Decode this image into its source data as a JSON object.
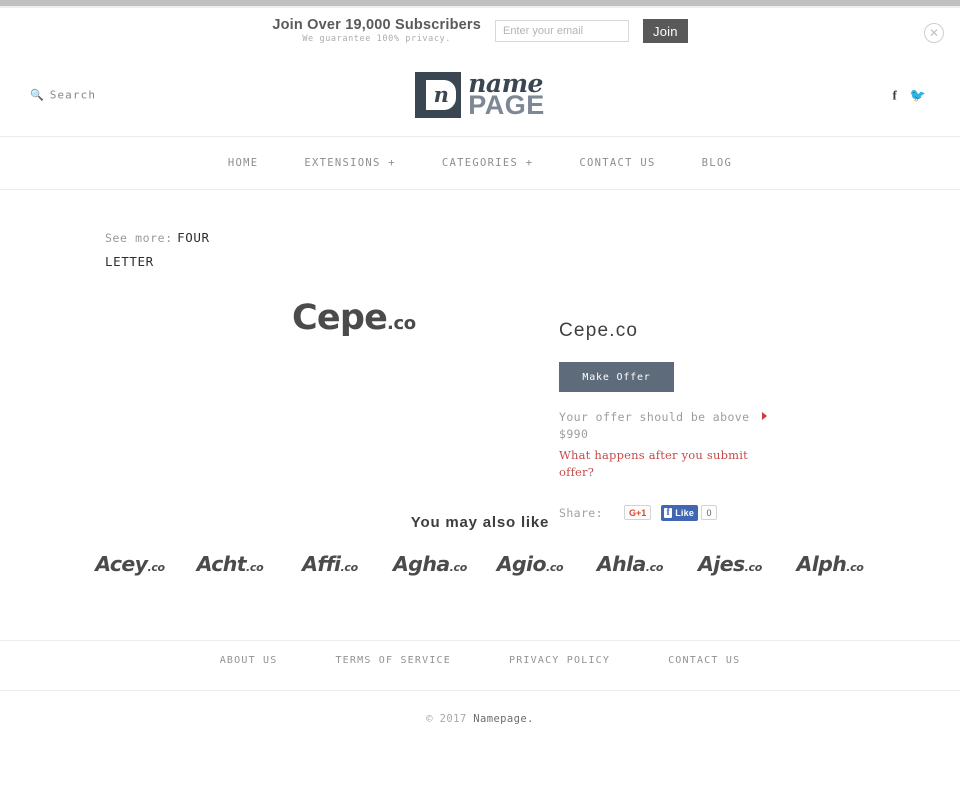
{
  "newsletter": {
    "title": "Join Over 19,000 Subscribers",
    "subtitle": "We guarantee 100% privacy.",
    "email_placeholder": "Enter your email",
    "email_value": "",
    "join_label": "Join",
    "close_icon": "close-circle-icon"
  },
  "header": {
    "search_label": "Search",
    "search_icon": "search-icon",
    "logo": {
      "mark_letter": "n",
      "word_top": "name",
      "word_bottom": "PAGE"
    },
    "social": [
      {
        "name": "facebook-icon",
        "glyph": "f"
      },
      {
        "name": "twitter-icon",
        "glyph": "🐦"
      }
    ]
  },
  "nav": {
    "items": [
      {
        "label": "HOME"
      },
      {
        "label": "EXTENSIONS +"
      },
      {
        "label": "CATEGORIES +"
      },
      {
        "label": "CONTACT US"
      },
      {
        "label": "BLOG"
      }
    ]
  },
  "breadcrumb": {
    "prefix": "See more:",
    "link": "FOUR LETTER"
  },
  "hero": {
    "name": "Cepe",
    "tld": ".co"
  },
  "offer": {
    "title": "Cepe.co",
    "button_label": "Make Offer",
    "note_line1": "Your offer should be above",
    "note_line2": "$990",
    "min_price": "$990",
    "help_link": "What happens after you submit offer?",
    "arrow_color": "#cf3a3a",
    "link_color": "#c64a4a",
    "button_color": "#5d6b7a"
  },
  "share": {
    "label": "Share:",
    "gplus_label": "G+1",
    "fb_like_label": "Like",
    "fb_count": "0"
  },
  "related": {
    "title": "You may also like",
    "items": [
      {
        "name": "Acey",
        "tld": ".co"
      },
      {
        "name": "Acht",
        "tld": ".co"
      },
      {
        "name": "Affi",
        "tld": ".co"
      },
      {
        "name": "Agha",
        "tld": ".co"
      },
      {
        "name": "Agio",
        "tld": ".co"
      },
      {
        "name": "Ahla",
        "tld": ".co"
      },
      {
        "name": "Ajes",
        "tld": ".co"
      },
      {
        "name": "Alph",
        "tld": ".co"
      }
    ]
  },
  "footer": {
    "links": [
      {
        "label": "ABOUT US"
      },
      {
        "label": "TERMS OF SERVICE"
      },
      {
        "label": "PRIVACY POLICY"
      },
      {
        "label": "CONTACT US"
      }
    ],
    "copyright_prefix": "© 2017 ",
    "copyright_brand": "Namepage."
  }
}
